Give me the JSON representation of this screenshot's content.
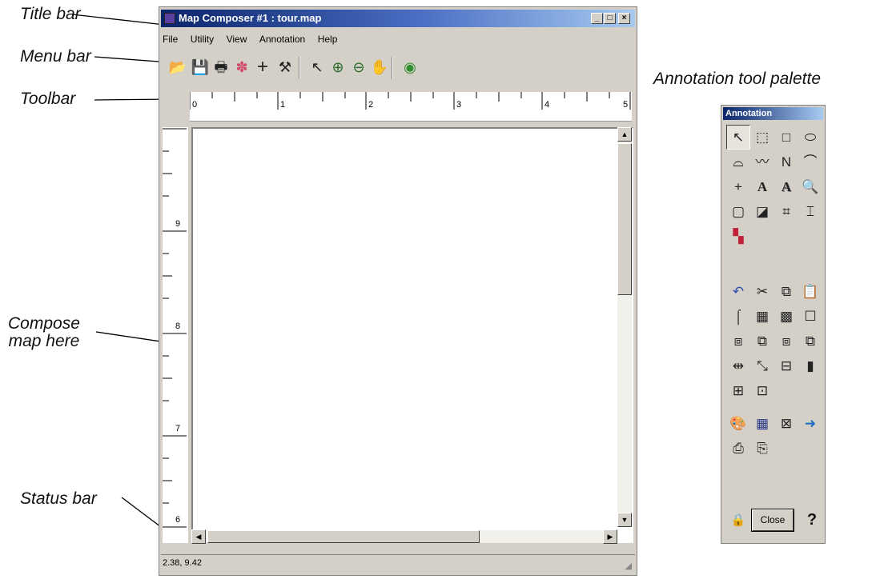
{
  "callouts": {
    "title_bar": "Title bar",
    "menu_bar": "Menu bar",
    "toolbar": "Toolbar",
    "compose_line1": "Compose",
    "compose_line2": "map here",
    "status_bar": "Status bar",
    "palette_caption": "Annotation tool palette"
  },
  "window": {
    "title": "Map Composer #1 : tour.map",
    "minimize": "_",
    "maximize": "□",
    "close": "×"
  },
  "menu": [
    "File",
    "Utility",
    "View",
    "Annotation",
    "Help"
  ],
  "toolbar": {
    "icons": [
      "open-icon",
      "save-icon",
      "print-icon",
      "layer-icon",
      "crosshair-icon",
      "hammer-icon",
      "select-arrow-icon",
      "zoom-in-icon",
      "zoom-out-icon",
      "pan-hand-icon",
      "refresh-icon"
    ],
    "glyphs": [
      "📂",
      "💾",
      "🖶",
      "✽",
      "+",
      "⚒",
      "↖",
      "⊕",
      "⊖",
      "✋",
      "◉"
    ]
  },
  "ruler": {
    "horizontal": [
      "0",
      "1",
      "2",
      "3",
      "4",
      "5"
    ],
    "vertical": [
      "9",
      "8",
      "7",
      "6"
    ]
  },
  "status": {
    "coordinates": "2.38, 9.42",
    "grip": "◢"
  },
  "palette": {
    "title": "Annotation",
    "rows": [
      [
        "↖",
        "⬚",
        "□",
        "⬭"
      ],
      [
        "⌓",
        "〰",
        "Ν",
        "⌒"
      ],
      [
        "+",
        "A",
        "A",
        "🔍"
      ],
      [
        "▢",
        "◪",
        "⌗",
        "⌶"
      ],
      [
        "▚"
      ],
      [
        "↶",
        "✂",
        "⧉",
        "📋"
      ],
      [
        "⌠",
        "▦",
        "▩",
        "☐"
      ],
      [
        "⧈",
        "⧉",
        "⧈",
        "⧉"
      ],
      [
        "⇹",
        "⤡",
        "⊟",
        "▮"
      ],
      [
        "⊞",
        "⊡"
      ],
      [
        "🎨",
        "▦",
        "⊠",
        "➜"
      ],
      [
        "⎙",
        "⎘"
      ]
    ],
    "lock": "🔒",
    "close_label": "Close",
    "help": "?"
  }
}
